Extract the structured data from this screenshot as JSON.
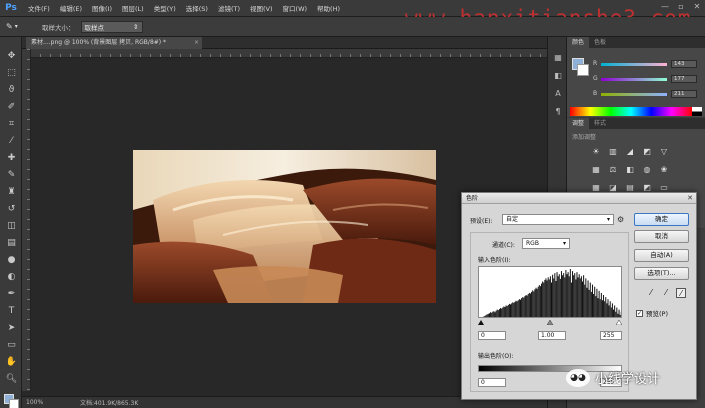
{
  "app": {
    "logo": "Ps"
  },
  "menu": [
    "文件(F)",
    "编辑(E)",
    "图像(I)",
    "图层(L)",
    "类型(Y)",
    "选择(S)",
    "滤镜(T)",
    "视图(V)",
    "窗口(W)",
    "帮助(H)"
  ],
  "window_controls": [
    "—",
    "▫",
    "✕"
  ],
  "watermark": "www.hanxitianshe3.com",
  "options": {
    "sample_size_label": "取样大小：",
    "sample_size_value": "取样点"
  },
  "document": {
    "tab_title": "素材....png @ 100% (背景图层 拷贝, RGB/8#) *",
    "zoom": "100%",
    "doc_info": "文档:401.9K/865.3K"
  },
  "color_panel": {
    "tabs": [
      "颜色",
      "色板"
    ],
    "rows": [
      {
        "letter": "R",
        "value": "143"
      },
      {
        "letter": "G",
        "value": "177"
      },
      {
        "letter": "B",
        "value": "211"
      }
    ],
    "fg_color": "#8fb1d8"
  },
  "adjustments_panel": {
    "tabs": [
      "调整",
      "样式"
    ],
    "title": "添加调整",
    "icons": [
      "brightness-icon",
      "levels-icon",
      "curves-icon",
      "exposure-icon",
      "vibrance-icon",
      "hue-icon",
      "balance-icon",
      "bw-icon",
      "photofilter-icon",
      "mixer-icon",
      "lookup-icon",
      "invert-icon",
      "posterize-icon",
      "threshold-icon",
      "gradientmap-icon",
      "selectivecolor-icon"
    ],
    "glyphs": [
      "☀",
      "▥",
      "◢",
      "◩",
      "▽",
      "▦",
      "⚖",
      "◧",
      "◍",
      "❀",
      "▦",
      "◪",
      "▤",
      "◩",
      "▭",
      "◫"
    ]
  },
  "levels_dialog": {
    "title": "色阶",
    "preset_label": "预设(E):",
    "preset_value": "自定",
    "channel_label": "通道(C):",
    "channel_value": "RGB",
    "input_label": "输入色阶(I):",
    "input_black": "0",
    "input_gamma": "1.00",
    "input_white": "255",
    "output_label": "输出色阶(O):",
    "output_black": "0",
    "output_white": "255",
    "buttons": {
      "ok": "确定",
      "cancel": "取消",
      "auto": "自动(A)",
      "options": "选项(T)..."
    },
    "preview_label": "预览(P)",
    "preview_checked": true,
    "histogram": [
      2,
      3,
      3,
      4,
      5,
      6,
      8,
      9,
      10,
      11,
      13,
      12,
      14,
      15,
      13,
      16,
      18,
      17,
      19,
      21,
      20,
      22,
      24,
      23,
      26,
      25,
      27,
      29,
      28,
      30,
      32,
      31,
      33,
      35,
      34,
      36,
      38,
      37,
      40,
      42,
      41,
      44,
      46,
      45,
      48,
      50,
      49,
      52,
      55,
      53,
      57,
      60,
      58,
      62,
      65,
      63,
      68,
      72,
      70,
      75,
      78,
      74,
      80,
      76,
      82,
      70,
      85,
      78,
      88,
      73,
      90,
      82,
      86,
      77,
      92,
      84,
      88,
      80,
      94,
      86,
      90,
      82,
      96,
      70,
      92,
      84,
      88,
      76,
      90,
      80,
      86,
      78,
      82,
      72,
      84,
      66,
      78,
      60,
      74,
      56,
      70,
      52,
      66,
      48,
      62,
      44,
      58,
      40,
      54,
      38,
      50,
      36,
      46,
      34,
      42,
      30,
      38,
      26,
      34,
      22,
      30,
      18,
      26,
      14,
      22,
      10,
      18,
      8,
      14,
      6
    ]
  },
  "wechat": {
    "label": "小线学设计"
  }
}
